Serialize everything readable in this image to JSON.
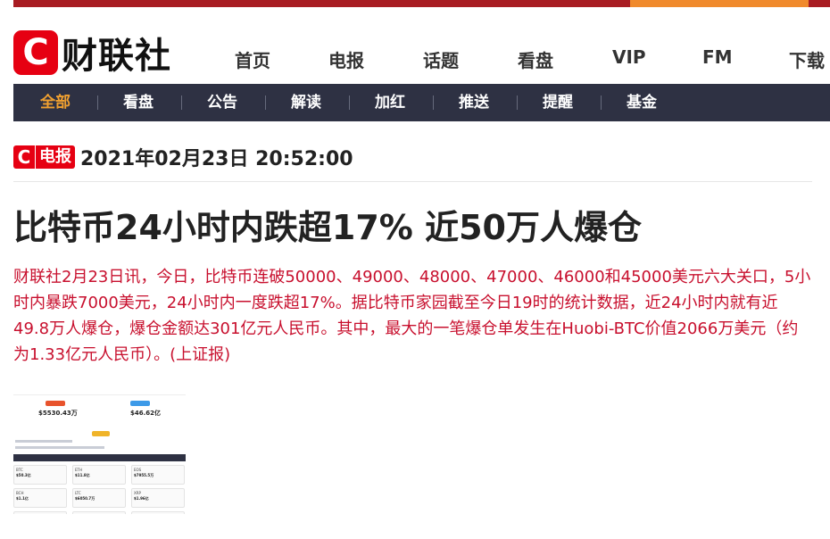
{
  "site": {
    "logo_mark": "C",
    "logo_text": "财联社",
    "brand_color": "#e60012"
  },
  "main_nav": [
    "首页",
    "电报",
    "话题",
    "看盘",
    "VIP",
    "FM",
    "下载"
  ],
  "sub_nav": {
    "active_color": "#f0a030",
    "items": [
      "全部",
      "看盘",
      "公告",
      "解读",
      "加红",
      "推送",
      "提醒",
      "基金"
    ]
  },
  "telegraph": {
    "badge_c": "C",
    "badge_word": "电报",
    "datetime": "2021年02月23日 20:52:00"
  },
  "article": {
    "headline": "比特币24小时内跌超17% 近50万人爆仓",
    "body": "财联社2月23日讯，今日，比特币连破50000、49000、48000、47000、46000和45000美元六大关口，5小时内暴跌7000美元，24小时内一度跌超17%。据比特币家园截至今日19时的统计数据，近24小时内就有近49.8万人爆仓，爆仓金额达301亿元人民币。其中，最大的一笔爆仓单发生在Huobi-BTC价值2066万美元（约为1.33亿元人民币）。(上证报)",
    "text_color": "#c8102e"
  },
  "thumbnail": {
    "card1_value": "$5530.43万",
    "card2_value": "$46.62亿",
    "cells": [
      {
        "name": "BTC",
        "value": "$50.3亿"
      },
      {
        "name": "ETH",
        "value": "$11.8亿"
      },
      {
        "name": "EOS",
        "value": "$7955.5万"
      },
      {
        "name": "BCH",
        "value": "$1.1亿"
      },
      {
        "name": "LTC",
        "value": "$6050.7万"
      },
      {
        "name": "XRP",
        "value": "$1.96亿"
      }
    ]
  }
}
